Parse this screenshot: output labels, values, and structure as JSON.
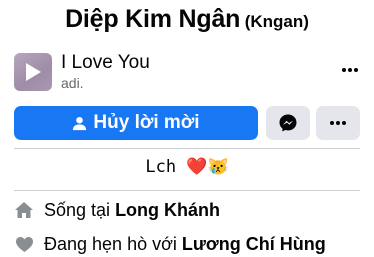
{
  "profile": {
    "name": "Diệp Kim Ngân",
    "alternate_name": "(Kngan)"
  },
  "music": {
    "title": "I Love You",
    "artist": "adi.",
    "thumb_icon": "play-icon",
    "more_icon": "more-horizontal-icon"
  },
  "actions": {
    "cancel_label": "Hủy lời mời",
    "cancel_icon": "person-icon",
    "messenger_icon": "messenger-icon",
    "more_icon": "more-horizontal-icon",
    "accent_color": "#1877f2"
  },
  "bio": {
    "text": "Lch ❤️😿"
  },
  "details": [
    {
      "icon": "home-icon",
      "prefix": "Sống tại ",
      "value": "Long Khánh"
    },
    {
      "icon": "heart-icon",
      "prefix": "Đang hẹn hò với ",
      "value": "Lương Chí Hùng"
    }
  ]
}
